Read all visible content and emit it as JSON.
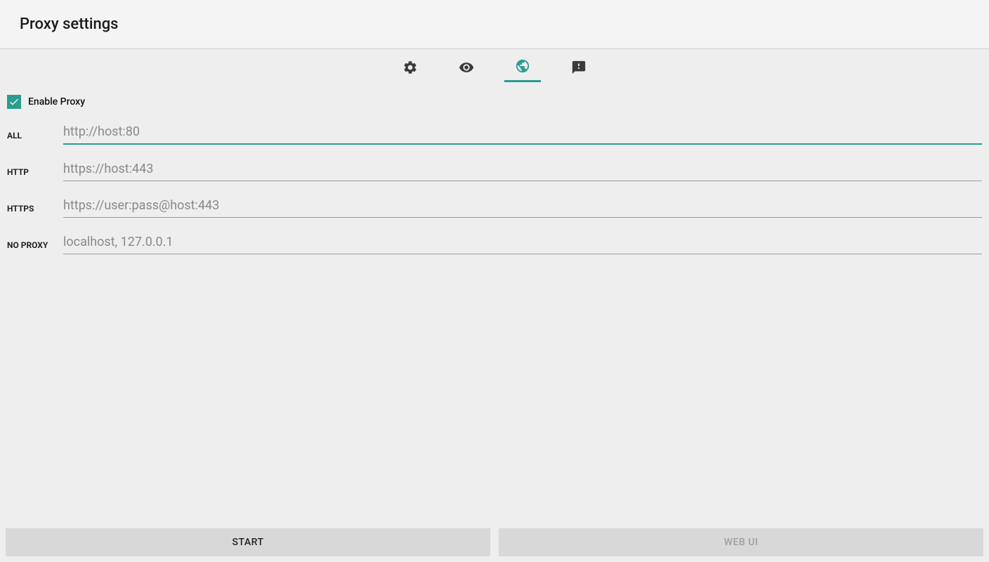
{
  "header": {
    "title": "Proxy settings"
  },
  "tabs": {
    "settings_icon": "gear-icon",
    "eye_icon": "eye-icon",
    "globe_icon": "globe-icon",
    "info_icon": "info-icon",
    "active_index": 2
  },
  "enable_proxy": {
    "label": "Enable Proxy",
    "checked": true
  },
  "fields": {
    "all": {
      "label": "ALL",
      "placeholder": "http://host:80",
      "value": "",
      "focused": true
    },
    "http": {
      "label": "HTTP",
      "placeholder": "https://host:443",
      "value": "",
      "focused": false
    },
    "https": {
      "label": "HTTPS",
      "placeholder": "https://user:pass@host:443",
      "value": "",
      "focused": false
    },
    "no_proxy": {
      "label": "NO PROXY",
      "placeholder": "localhost, 127.0.0.1",
      "value": "",
      "focused": false
    }
  },
  "footer": {
    "start_label": "START",
    "webui_label": "WEB UI",
    "webui_enabled": false
  },
  "colors": {
    "accent": "#2a9d8f",
    "icon_inactive": "#3a3a3a"
  }
}
